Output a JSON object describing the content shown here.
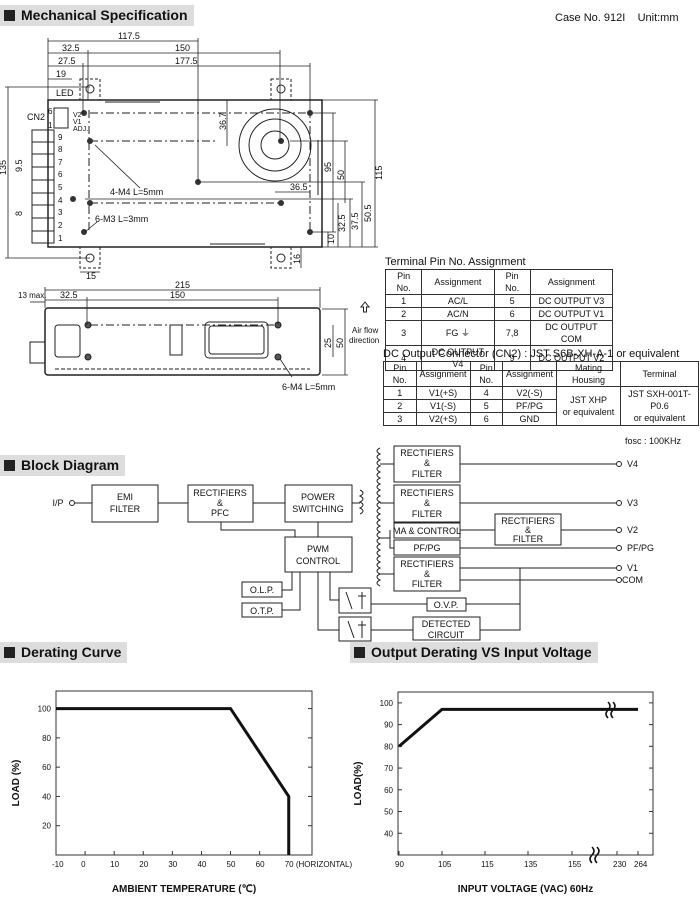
{
  "header": {
    "case_no": "Case No. 912I",
    "unit": "Unit:mm"
  },
  "sections": {
    "mechanical": "Mechanical Specification",
    "block": "Block Diagram",
    "derating": "Derating Curve",
    "output_derating": "Output Derating VS Input Voltage"
  },
  "mech": {
    "dims": [
      "117.5",
      "32.5",
      "150",
      "27.5",
      "177.5",
      "19",
      "135",
      "115",
      "95",
      "50",
      "50.5",
      "37.5",
      "32.5",
      "10",
      "36.7",
      "36.5",
      "16",
      "15",
      "9.5",
      "8"
    ],
    "labels": {
      "led": "LED",
      "cn2": "CN2",
      "v2": "V2",
      "v1": "V1",
      "adj": "ADJ.",
      "pin6": "6",
      "pin1": "1",
      "m4": "4-M4 L=5mm",
      "m3": "6-M3 L=3mm"
    },
    "terminals": [
      "9",
      "8",
      "7",
      "6",
      "5",
      "4",
      "3",
      "2",
      "1"
    ],
    "side": {
      "dims": [
        "215",
        "13 max.",
        "32.5",
        "150",
        "25",
        "50"
      ],
      "airflow_1": "Air flow",
      "airflow_2": "direction",
      "m4": "6-M4 L=5mm"
    }
  },
  "terminal_table": {
    "title": "Terminal Pin No.  Assignment",
    "headers": [
      "Pin No.",
      "Assignment",
      "Pin No.",
      "Assignment"
    ],
    "rows": [
      [
        "1",
        "AC/L",
        "5",
        "DC OUTPUT V3"
      ],
      [
        "2",
        "AC/N",
        "6",
        "DC OUTPUT V1"
      ],
      [
        "3",
        "FG ⏚",
        "7,8",
        "DC OUTPUT COM"
      ],
      [
        "4",
        "DC OUTPUT V4",
        "9",
        "DC OUTPUT V2"
      ]
    ]
  },
  "cn2_table": {
    "title": "DC Output Connector (CN2) : JST S6B-XH-A-1 or equivalent",
    "headers": [
      "Pin No.",
      "Assignment",
      "Pin No.",
      "Assignment",
      "Mating Housing",
      "Terminal"
    ],
    "rows": [
      [
        "1",
        "V1(+S)",
        "4",
        "V2(-S)"
      ],
      [
        "2",
        "V1(-S)",
        "5",
        "PF/PG"
      ],
      [
        "3",
        "V2(+S)",
        "6",
        "GND"
      ]
    ],
    "housing": [
      "JST XHP",
      "or equivalent"
    ],
    "terminal": [
      "JST SXH-001T-P0.6",
      "or equivalent"
    ]
  },
  "block": {
    "fosc": "fosc : 100KHz",
    "ip": "I/P",
    "emi": [
      "EMI",
      "FILTER"
    ],
    "rect_pfc": [
      "RECTIFIERS",
      "&",
      "PFC"
    ],
    "power_sw": [
      "POWER",
      "SWITCHING"
    ],
    "pwm": [
      "PWM",
      "CONTROL"
    ],
    "rect_filter": [
      "RECTIFIERS",
      "&",
      "FILTER"
    ],
    "ma_control": "MA & CONTROL",
    "pfpg": "PF/PG",
    "olp": "O.L.P.",
    "otp": "O.T.P.",
    "ovp": "O.V.P.",
    "detected": [
      "DETECTED",
      "CIRCUIT"
    ],
    "outputs": [
      "V4",
      "V3",
      "V2",
      "PF/PG",
      "V1",
      "COM"
    ]
  },
  "chart_data": [
    {
      "type": "line",
      "title": "Derating Curve",
      "xlabel": "AMBIENT TEMPERATURE (℃)",
      "ylabel": "LOAD (%)",
      "x_ticks": [
        "-10",
        "0",
        "10",
        "20",
        "30",
        "40",
        "50",
        "60",
        "70 (HORIZONTAL)"
      ],
      "y_ticks": [
        "20",
        "40",
        "60",
        "80",
        "100"
      ],
      "xlim": [
        -10,
        78
      ],
      "ylim": [
        0,
        112
      ],
      "points": [
        [
          -10,
          100
        ],
        [
          50,
          100
        ],
        [
          70,
          40
        ],
        [
          70,
          0
        ]
      ],
      "color": "#111111"
    },
    {
      "type": "line",
      "title": "Output Derating VS Input Voltage",
      "xlabel": "INPUT VOLTAGE (VAC) 60Hz",
      "ylabel": "LOAD(%)",
      "x_ticks": [
        "90",
        "105",
        "115",
        "135",
        "155",
        "230",
        "264"
      ],
      "y_ticks": [
        "40",
        "50",
        "60",
        "70",
        "80",
        "90",
        "100"
      ],
      "ylim": [
        30,
        105
      ],
      "axis_break": true,
      "points": [
        [
          90,
          80
        ],
        [
          105,
          97
        ],
        [
          264,
          97
        ]
      ],
      "color": "#111111"
    }
  ]
}
